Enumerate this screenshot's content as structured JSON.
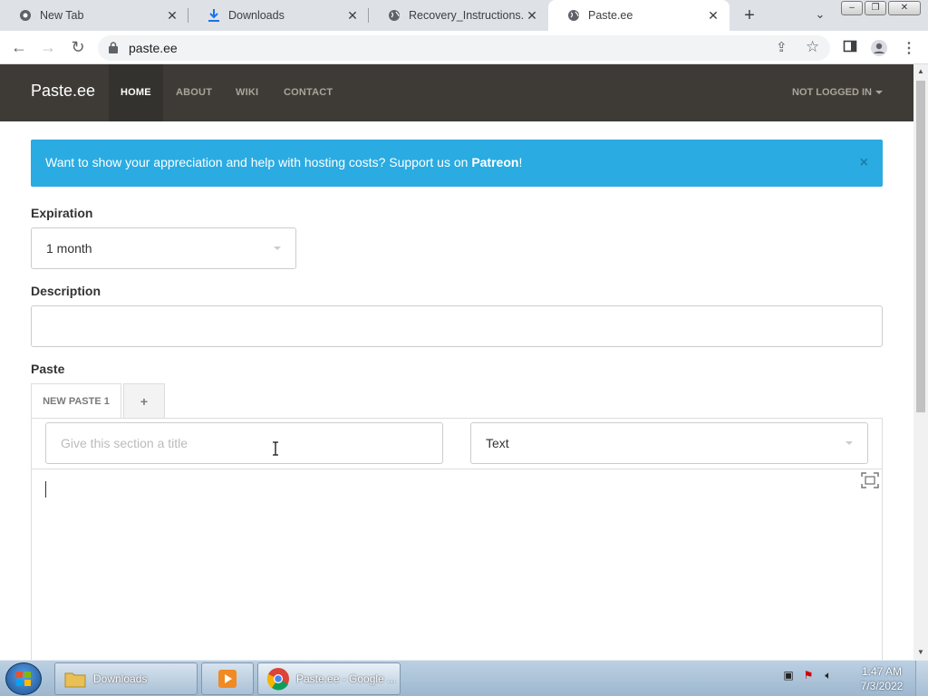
{
  "browser": {
    "tabs": [
      {
        "title": "New Tab",
        "icon": "chrome-icon"
      },
      {
        "title": "Downloads",
        "icon": "download-icon"
      },
      {
        "title": "Recovery_Instructions.htm",
        "icon": "globe-icon"
      },
      {
        "title": "Paste.ee",
        "icon": "globe-icon",
        "active": true
      }
    ],
    "url": "paste.ee"
  },
  "site": {
    "brand": "Paste.ee",
    "nav": [
      "HOME",
      "ABOUT",
      "WIKI",
      "CONTACT"
    ],
    "login": "NOT LOGGED IN",
    "alert": {
      "text": "Want to show your appreciation and help with hosting costs? Support us on ",
      "link": "Patreon",
      "suffix": "!",
      "close": "×"
    },
    "form": {
      "expiration_label": "Expiration",
      "expiration_value": "1 month",
      "description_label": "Description",
      "description_value": "",
      "paste_label": "Paste",
      "paste_tab": "NEW PASTE 1",
      "add_tab": "+",
      "section_title_placeholder": "Give this section a title",
      "syntax_value": "Text"
    }
  },
  "taskbar": {
    "tasks": [
      {
        "label": "Downloads",
        "icon": "folder-icon"
      },
      {
        "label": "",
        "icon": "media-player-icon"
      },
      {
        "label": "Paste.ee - Google ...",
        "icon": "chrome-icon"
      }
    ],
    "time": "1:47 AM",
    "date": "7/3/2022"
  },
  "colors": {
    "navbar": "#3e3b36",
    "alert": "#2aabe2"
  }
}
